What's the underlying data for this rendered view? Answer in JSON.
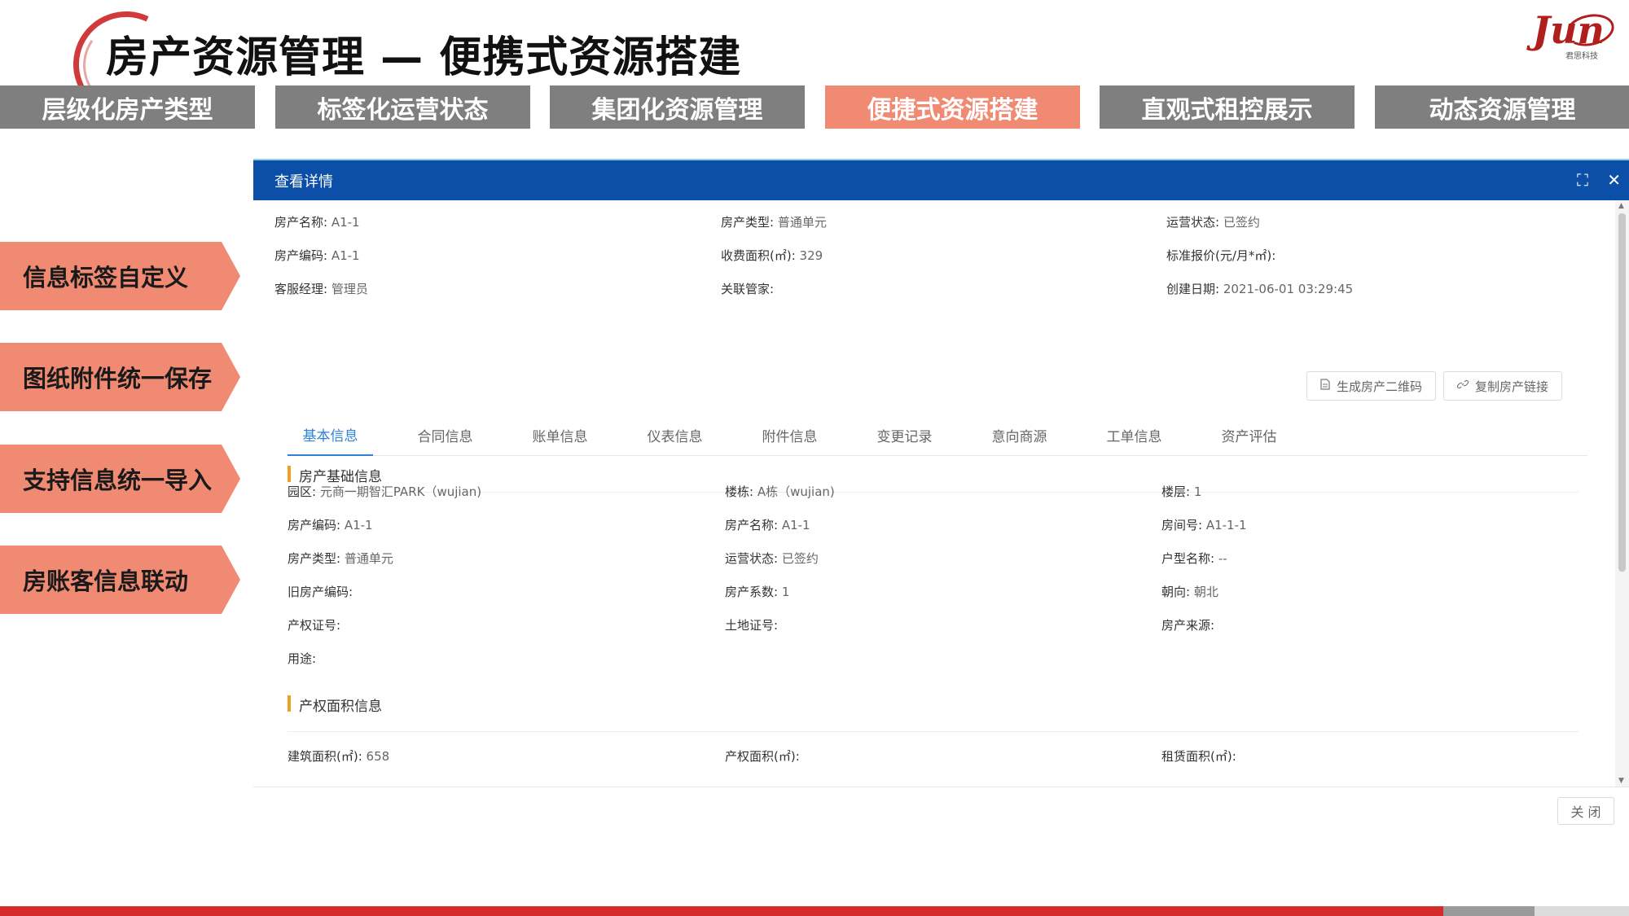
{
  "page": {
    "title": "房产资源管理 — 便携式资源搭建",
    "logo_text": "Jun",
    "logo_sub": "君思科技"
  },
  "top_tabs": [
    {
      "label": "层级化房产类型",
      "active": false
    },
    {
      "label": "标签化运营状态",
      "active": false
    },
    {
      "label": "集团化资源管理",
      "active": false
    },
    {
      "label": "便捷式资源搭建",
      "active": true
    },
    {
      "label": "直观式租控展示",
      "active": false
    },
    {
      "label": "动态资源管理",
      "active": false
    }
  ],
  "side_labels": [
    "信息标签自定义",
    "图纸附件统一保存",
    "支持信息统一导入",
    "房账客信息联动"
  ],
  "modal": {
    "title": "查看详情",
    "expand_glyph": "⛶",
    "close_glyph": "✕",
    "header_fields": [
      [
        {
          "label": "房产名称:",
          "value": "A1-1"
        },
        {
          "label": "房产类型:",
          "value": "普通单元"
        },
        {
          "label": "运营状态:",
          "value": "已签约"
        }
      ],
      [
        {
          "label": "房产编码:",
          "value": "A1-1"
        },
        {
          "label": "收费面积(㎡):",
          "value": "329"
        },
        {
          "label": "标准报价(元/月*㎡):",
          "value": ""
        }
      ],
      [
        {
          "label": "客服经理:",
          "value": "管理员"
        },
        {
          "label": "关联管家:",
          "value": ""
        },
        {
          "label": "创建日期:",
          "value": "2021-06-01 03:29:45"
        }
      ]
    ],
    "buttons": {
      "qrcode": "生成房产二维码",
      "copy_link": "复制房产链接"
    },
    "tabs": [
      {
        "label": "基本信息",
        "active": true
      },
      {
        "label": "合同信息",
        "active": false
      },
      {
        "label": "账单信息",
        "active": false
      },
      {
        "label": "仪表信息",
        "active": false
      },
      {
        "label": "附件信息",
        "active": false
      },
      {
        "label": "变更记录",
        "active": false
      },
      {
        "label": "意向商源",
        "active": false
      },
      {
        "label": "工单信息",
        "active": false
      },
      {
        "label": "资产评估",
        "active": false
      }
    ],
    "basic_section": {
      "title": "房产基础信息",
      "rows": [
        [
          {
            "label": "园区:",
            "value": "元商一期智汇PARK（wujian)"
          },
          {
            "label": "楼栋:",
            "value": "A栋（wujian)"
          },
          {
            "label": "楼层:",
            "value": "1"
          }
        ],
        [
          {
            "label": "房产编码:",
            "value": "A1-1"
          },
          {
            "label": "房产名称:",
            "value": "A1-1"
          },
          {
            "label": "房间号:",
            "value": "A1-1-1"
          }
        ],
        [
          {
            "label": "房产类型:",
            "value": "普通单元"
          },
          {
            "label": "运营状态:",
            "value": "已签约"
          },
          {
            "label": "户型名称:",
            "value": "--"
          }
        ],
        [
          {
            "label": "旧房产编码:",
            "value": ""
          },
          {
            "label": "房产系数:",
            "value": "1"
          },
          {
            "label": "朝向:",
            "value": "朝北"
          }
        ],
        [
          {
            "label": "产权证号:",
            "value": ""
          },
          {
            "label": "土地证号:",
            "value": ""
          },
          {
            "label": "房产来源:",
            "value": ""
          }
        ],
        [
          {
            "label": "用途:",
            "value": ""
          }
        ]
      ]
    },
    "area_section": {
      "title": "产权面积信息",
      "rows": [
        [
          {
            "label": "建筑面积(㎡):",
            "value": "658"
          },
          {
            "label": "产权面积(㎡):",
            "value": ""
          },
          {
            "label": "租赁面积(㎡):",
            "value": ""
          }
        ]
      ]
    },
    "footer": {
      "close_label": "关 闭"
    }
  },
  "colors": {
    "accent": "#f08a73",
    "tab_gray": "#7f7f7f",
    "modal_header": "#0b4fa8",
    "link_blue": "#2f82d6",
    "section_marker": "#f0a020",
    "bottom_red": "#d42b2b"
  }
}
